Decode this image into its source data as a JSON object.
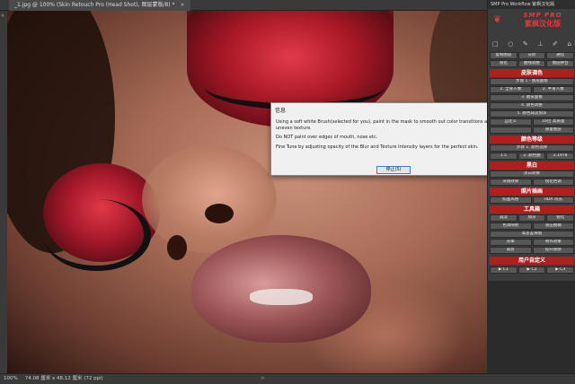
{
  "document_tab": {
    "title": "_1.jpg @ 100% (Skin Retouch Pro (Head Shot), 图层蒙版/8) *",
    "close_glyph": "×"
  },
  "dialog": {
    "title": "信息",
    "lines": [
      "Using a soft white Brush(selected for you), paint in the mask to smooth out color transitions and uneven texture.",
      "Do NOT paint over edges of mouth, nose etc.",
      "Fine Tune by adjusting opacity of the Blur and Texture Intensity layers for the perfect skin."
    ],
    "button_label": "停止(S)"
  },
  "panel": {
    "title": "SMP Pro Workflow 紫枫汉化版",
    "logo_line1": "SMP PRO",
    "logo_line2": "紫枫汉化版",
    "tools": [
      "□",
      "○",
      "✎",
      "⊥",
      "✐",
      "⌂"
    ],
    "rows": [
      [
        "复制图层",
        "灰阶",
        "通化"
      ],
      [
        "液化",
        "曲线调整",
        "图层拼合"
      ],
      [
        "皮肤调色"
      ],
      [
        "步骤 1 - 图层面板"
      ],
      [
        "2. 全身人像",
        "2. 半身人像"
      ],
      [
        "3. 磨皮面板"
      ],
      [
        "4. 颜色调整"
      ],
      [
        "5. 肤色减淡加深"
      ],
      [
        "自定义",
        "16位 高质量"
      ],
      [
        "",
        "质量图层"
      ],
      [
        "颜色等级"
      ],
      [
        "步骤 1. 颜色选择"
      ],
      [
        "1.5",
        "2. 颜色曲",
        "2.1978"
      ],
      [
        "黑白"
      ],
      [
        "黑白转换"
      ],
      [
        "深镜效果",
        "锐化色调"
      ],
      [
        "照片插画"
      ],
      [
        "照面风格",
        "HDR 风光"
      ],
      [
        "工具箱"
      ],
      [
        "减淡",
        "加深",
        "锐化"
      ],
      [
        "色调映射",
        "液压模糊"
      ],
      [
        "高反差保留"
      ],
      [
        "光晕",
        "制作效果"
      ],
      [
        "裁剪",
        "提升质感"
      ],
      [
        "用户自定义"
      ],
      [
        "▶ C1",
        "▶ C2",
        "▶ C3"
      ]
    ]
  },
  "status": {
    "zoom": "100%",
    "doc_info": "74.08 厘米 x 48.12 厘米 (72 ppi)",
    "arrow_glyph": ">"
  },
  "colors": {
    "accent_red": "#b01e1e",
    "panel_bg": "#3c3c3c",
    "logo_red": "#e23b3b"
  }
}
